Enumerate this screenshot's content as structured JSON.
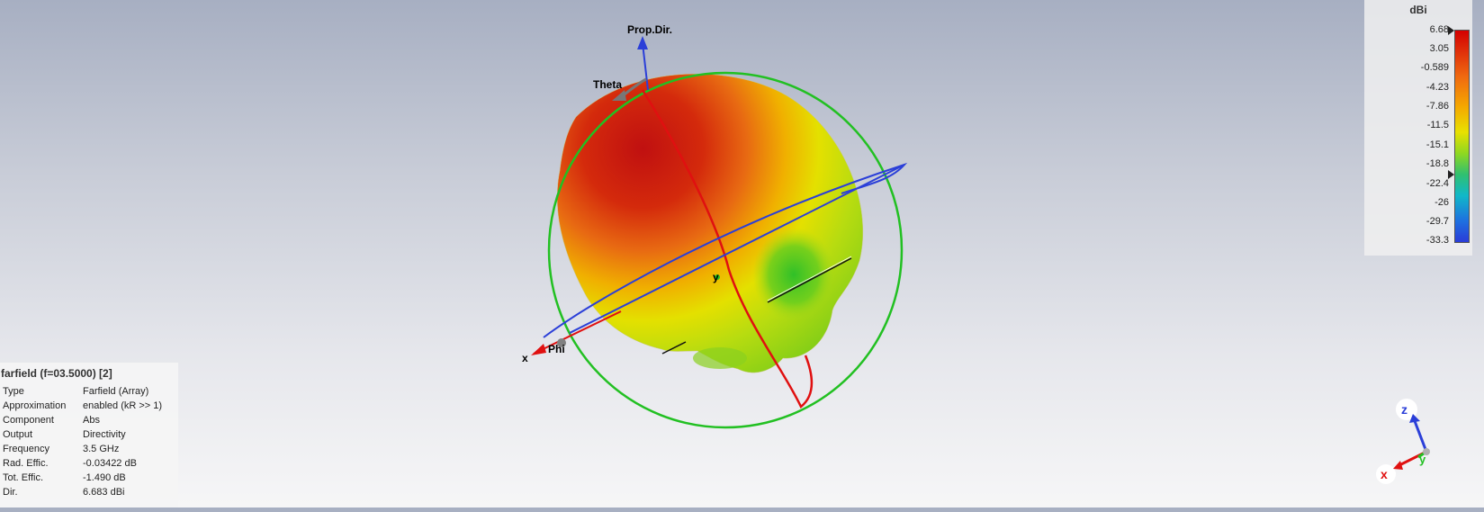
{
  "plot": {
    "prop_dir_label": "Prop.Dir.",
    "theta_label": "Theta",
    "phi_label": "Phi",
    "x_axis_label": "x",
    "y_axis_label": "y"
  },
  "legend": {
    "unit": "dBi",
    "ticks": [
      "6.68",
      "3.05",
      "-0.589",
      "-4.23",
      "-7.86",
      "-11.5",
      "-15.1",
      "-18.8",
      "-22.4",
      "-26",
      "-29.7",
      "-33.3"
    ],
    "max_marker_value": "6.68",
    "min_marker_value": "-18.8"
  },
  "info": {
    "title": "farfield (f=03.5000) [2]",
    "rows": [
      {
        "key": "Type",
        "value": "Farfield (Array)"
      },
      {
        "key": "Approximation",
        "value": "enabled (kR >> 1)"
      },
      {
        "key": "Component",
        "value": "Abs"
      },
      {
        "key": "Output",
        "value": "Directivity"
      },
      {
        "key": "Frequency",
        "value": "3.5 GHz"
      },
      {
        "key": "Rad. Effic.",
        "value": "-0.03422 dB"
      },
      {
        "key": "Tot. Effic.",
        "value": "-1.490 dB"
      },
      {
        "key": "Dir.",
        "value": "6.683 dBi"
      }
    ]
  },
  "triad": {
    "x_label": "x",
    "y_label": "y",
    "z_label": "z"
  },
  "colors": {
    "axis_blue": "#2b3fd8",
    "axis_red": "#e01010",
    "ring_green": "#22c022",
    "pattern_max": "#cc1010",
    "pattern_mid": "#e8e000",
    "pattern_min": "#40c020"
  }
}
